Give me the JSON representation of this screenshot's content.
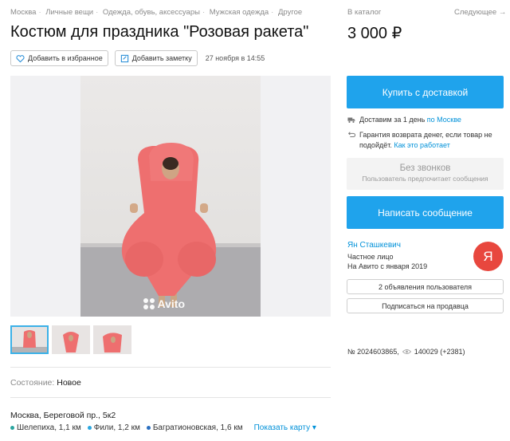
{
  "breadcrumbs": [
    "Москва",
    "Личные вещи",
    "Одежда, обувь, аксессуары",
    "Мужская одежда",
    "Другое"
  ],
  "nav": {
    "catalog": "В каталог",
    "next": "Следующее →"
  },
  "listing": {
    "title": "Костюм для праздника \"Розовая ракета\"",
    "price": "3 000 ₽",
    "favorite_label": "Добавить в избранное",
    "note_label": "Добавить заметку",
    "date": "27 ноября в 14:55",
    "watermark": "Avito",
    "condition_label": "Состояние:",
    "condition_value": "Новое",
    "address": "Москва, Береговой пр., 5к2",
    "metros": [
      {
        "name": "Шелепиха, 1,1 км",
        "color": "#2aa59f"
      },
      {
        "name": "Фили, 1,2 км",
        "color": "#2ba7e0"
      },
      {
        "name": "Багратионовская, 1,6 км",
        "color": "#2b6fc0"
      }
    ],
    "show_map": "Показать карту ▾",
    "id_text": "№ 2024603865,",
    "views": "140029 (+2381)"
  },
  "sidebar": {
    "buy_label": "Купить с доставкой",
    "delivery_text": "Доставим за 1 день",
    "delivery_link": "по Москве",
    "guarantee_text": "Гарантия возврата денег, если товар не подойдёт.",
    "guarantee_link": "Как это работает",
    "no_calls_title": "Без звонков",
    "no_calls_sub": "Пользователь предпочитает сообщения",
    "message_label": "Написать сообщение",
    "seller_name": "Ян Сташкевич",
    "seller_type": "Частное лицо",
    "seller_since": "На Авито с января 2019",
    "avatar_letter": "Я",
    "ads_label": "2 объявления пользователя",
    "subscribe_label": "Подписаться на продавца"
  },
  "colors": {
    "accent": "#1fa3ec",
    "link": "#0091d9",
    "avatar": "#e8473e",
    "costume": "#ee6f6f"
  }
}
